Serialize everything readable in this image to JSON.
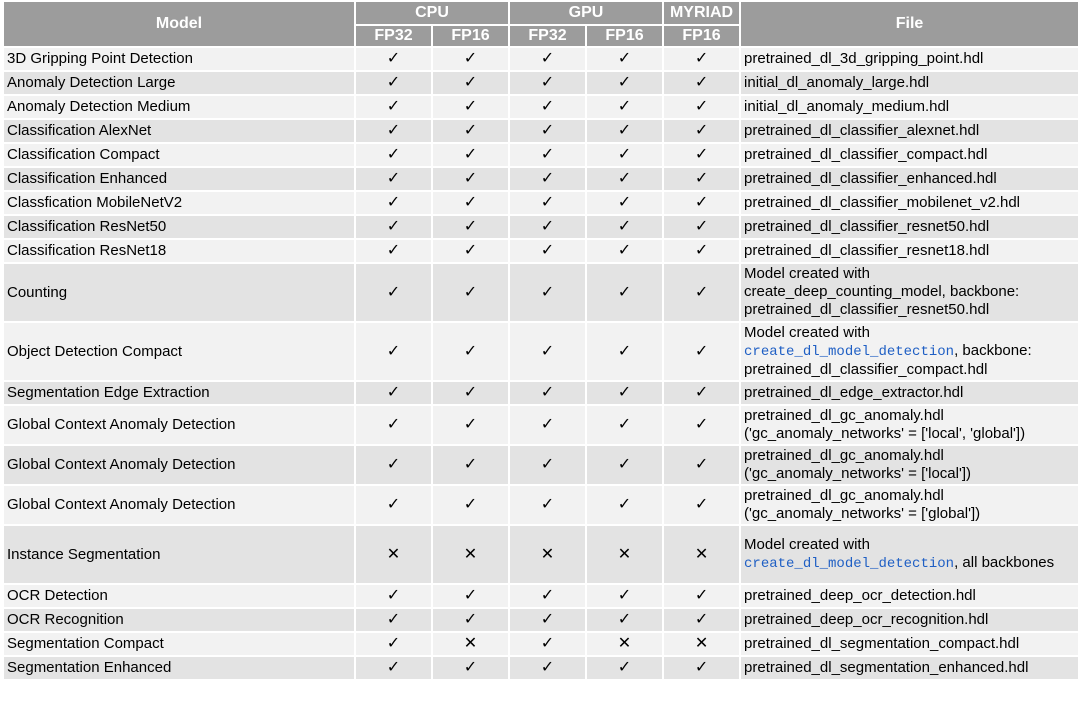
{
  "header": {
    "model": "Model",
    "cpu": "CPU",
    "gpu": "GPU",
    "myriad": "MYRIAD",
    "file": "File",
    "fp32": "FP32",
    "fp16": "FP16"
  },
  "symbols": {
    "yes": "✓",
    "no": "✕"
  },
  "rows": [
    {
      "model": "3D Gripping Point Detection",
      "cpu_fp32": "✓",
      "cpu_fp16": "✓",
      "gpu_fp32": "✓",
      "gpu_fp16": "✓",
      "myriad_fp16": "✓",
      "file_pre": "pretrained_dl_3d_gripping_point.hdl",
      "file_code": "",
      "file_post": ""
    },
    {
      "model": "Anomaly Detection Large",
      "cpu_fp32": "✓",
      "cpu_fp16": "✓",
      "gpu_fp32": "✓",
      "gpu_fp16": "✓",
      "myriad_fp16": "✓",
      "file_pre": "initial_dl_anomaly_large.hdl",
      "file_code": "",
      "file_post": ""
    },
    {
      "model": "Anomaly Detection Medium",
      "cpu_fp32": "✓",
      "cpu_fp16": "✓",
      "gpu_fp32": "✓",
      "gpu_fp16": "✓",
      "myriad_fp16": "✓",
      "file_pre": "initial_dl_anomaly_medium.hdl",
      "file_code": "",
      "file_post": ""
    },
    {
      "model": "Classification AlexNet",
      "cpu_fp32": "✓",
      "cpu_fp16": "✓",
      "gpu_fp32": "✓",
      "gpu_fp16": "✓",
      "myriad_fp16": "✓",
      "file_pre": "pretrained_dl_classifier_alexnet.hdl",
      "file_code": "",
      "file_post": ""
    },
    {
      "model": "Classification Compact",
      "cpu_fp32": "✓",
      "cpu_fp16": "✓",
      "gpu_fp32": "✓",
      "gpu_fp16": "✓",
      "myriad_fp16": "✓",
      "file_pre": "pretrained_dl_classifier_compact.hdl",
      "file_code": "",
      "file_post": ""
    },
    {
      "model": "Classification Enhanced",
      "cpu_fp32": "✓",
      "cpu_fp16": "✓",
      "gpu_fp32": "✓",
      "gpu_fp16": "✓",
      "myriad_fp16": "✓",
      "file_pre": "pretrained_dl_classifier_enhanced.hdl",
      "file_code": "",
      "file_post": ""
    },
    {
      "model": "Classfication MobileNetV2",
      "cpu_fp32": "✓",
      "cpu_fp16": "✓",
      "gpu_fp32": "✓",
      "gpu_fp16": "✓",
      "myriad_fp16": "✓",
      "file_pre": "pretrained_dl_classifier_mobilenet_v2.hdl",
      "file_code": "",
      "file_post": ""
    },
    {
      "model": "Classification ResNet50",
      "cpu_fp32": "✓",
      "cpu_fp16": "✓",
      "gpu_fp32": "✓",
      "gpu_fp16": "✓",
      "myriad_fp16": "✓",
      "file_pre": "pretrained_dl_classifier_resnet50.hdl",
      "file_code": "",
      "file_post": ""
    },
    {
      "model": "Classification ResNet18",
      "cpu_fp32": "✓",
      "cpu_fp16": "✓",
      "gpu_fp32": "✓",
      "gpu_fp16": "✓",
      "myriad_fp16": "✓",
      "file_pre": "pretrained_dl_classifier_resnet18.hdl",
      "file_code": "",
      "file_post": ""
    },
    {
      "model": "Counting",
      "cpu_fp32": "✓",
      "cpu_fp16": "✓",
      "gpu_fp32": "✓",
      "gpu_fp16": "✓",
      "myriad_fp16": "✓",
      "file_pre": "Model created with create_deep_counting_model, backbone: pretrained_dl_classifier_resnet50.hdl",
      "file_code": "",
      "file_post": ""
    },
    {
      "model": "Object Detection Compact",
      "cpu_fp32": "✓",
      "cpu_fp16": "✓",
      "gpu_fp32": "✓",
      "gpu_fp16": "✓",
      "myriad_fp16": "✓",
      "file_pre": "Model created with",
      "file_code": "create_dl_model_detection",
      "file_post": ", backbone: pretrained_dl_classifier_compact.hdl"
    },
    {
      "model": "Segmentation Edge Extraction",
      "cpu_fp32": "✓",
      "cpu_fp16": "✓",
      "gpu_fp32": "✓",
      "gpu_fp16": "✓",
      "myriad_fp16": "✓",
      "file_pre": "pretrained_dl_edge_extractor.hdl",
      "file_code": "",
      "file_post": ""
    },
    {
      "model": "Global Context Anomaly Detection",
      "cpu_fp32": "✓",
      "cpu_fp16": "✓",
      "gpu_fp32": "✓",
      "gpu_fp16": "✓",
      "myriad_fp16": "✓",
      "file_pre": "pretrained_dl_gc_anomaly.hdl ('gc_anomaly_networks' = ['local', 'global'])",
      "file_code": "",
      "file_post": ""
    },
    {
      "model": "Global Context Anomaly Detection",
      "cpu_fp32": "✓",
      "cpu_fp16": "✓",
      "gpu_fp32": "✓",
      "gpu_fp16": "✓",
      "myriad_fp16": "✓",
      "file_pre": "pretrained_dl_gc_anomaly.hdl ('gc_anomaly_networks' = ['local'])",
      "file_code": "",
      "file_post": ""
    },
    {
      "model": "Global Context Anomaly Detection",
      "cpu_fp32": "✓",
      "cpu_fp16": "✓",
      "gpu_fp32": "✓",
      "gpu_fp16": "✓",
      "myriad_fp16": "✓",
      "file_pre": "pretrained_dl_gc_anomaly.hdl ('gc_anomaly_networks' = ['global'])",
      "file_code": "",
      "file_post": ""
    },
    {
      "model": "Instance Segmentation",
      "cpu_fp32": "✕",
      "cpu_fp16": "✕",
      "gpu_fp32": "✕",
      "gpu_fp16": "✕",
      "myriad_fp16": "✕",
      "file_pre": "Model created with",
      "file_code": "create_dl_model_detection",
      "file_post": ", all backbones"
    },
    {
      "model": "OCR Detection",
      "cpu_fp32": "✓",
      "cpu_fp16": "✓",
      "gpu_fp32": "✓",
      "gpu_fp16": "✓",
      "myriad_fp16": "✓",
      "file_pre": "pretrained_deep_ocr_detection.hdl",
      "file_code": "",
      "file_post": ""
    },
    {
      "model": "OCR Recognition",
      "cpu_fp32": "✓",
      "cpu_fp16": "✓",
      "gpu_fp32": "✓",
      "gpu_fp16": "✓",
      "myriad_fp16": "✓",
      "file_pre": "pretrained_deep_ocr_recognition.hdl",
      "file_code": "",
      "file_post": ""
    },
    {
      "model": "Segmentation Compact",
      "cpu_fp32": "✓",
      "cpu_fp16": "✕",
      "gpu_fp32": "✓",
      "gpu_fp16": "✕",
      "myriad_fp16": "✕",
      "file_pre": "pretrained_dl_segmentation_compact.hdl",
      "file_code": "",
      "file_post": ""
    },
    {
      "model": "Segmentation Enhanced",
      "cpu_fp32": "✓",
      "cpu_fp16": "✓",
      "gpu_fp32": "✓",
      "gpu_fp16": "✓",
      "myriad_fp16": "✓",
      "file_pre": "pretrained_dl_segmentation_enhanced.hdl",
      "file_code": "",
      "file_post": ""
    }
  ]
}
